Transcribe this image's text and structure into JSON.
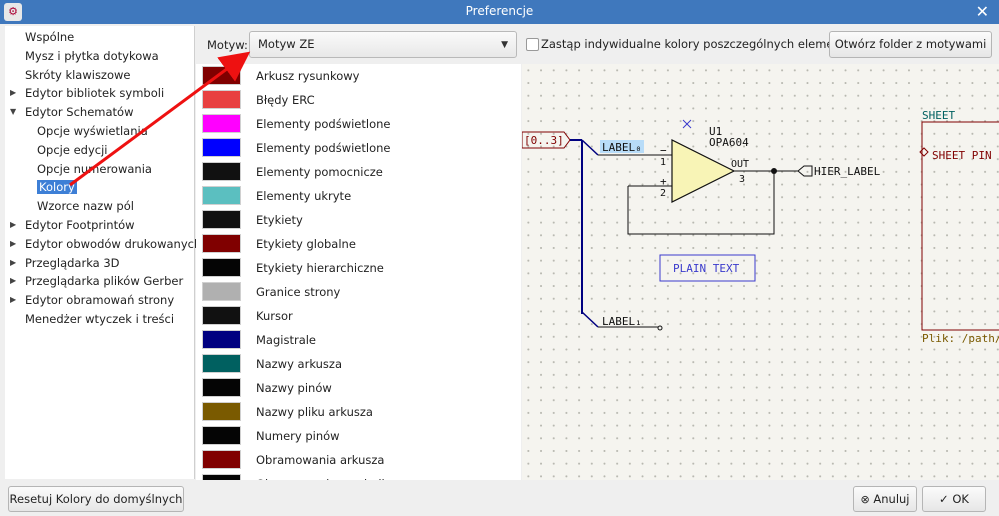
{
  "window": {
    "title": "Preferencje",
    "close_glyph": "✕",
    "app_icon": "kicad-icon"
  },
  "tree": [
    {
      "label": "Wspólne",
      "expandable": false
    },
    {
      "label": "Mysz i płytka dotykowa",
      "expandable": false
    },
    {
      "label": "Skróty klawiszowe",
      "expandable": false
    },
    {
      "label": "Edytor bibliotek symboli",
      "expandable": true,
      "expanded": false
    },
    {
      "label": "Edytor Schematów",
      "expandable": true,
      "expanded": true
    },
    {
      "label": "Opcje wyświetlania",
      "child": true
    },
    {
      "label": "Opcje edycji",
      "child": true
    },
    {
      "label": "Opcje numerowania",
      "child": true
    },
    {
      "label": "Kolory",
      "child": true,
      "selected": true
    },
    {
      "label": "Wzorce nazw pól",
      "child": true
    },
    {
      "label": "Edytor Footprintów",
      "expandable": true,
      "expanded": false
    },
    {
      "label": "Edytor obwodów drukowanych",
      "expandable": true,
      "expanded": false
    },
    {
      "label": "Przeglądarka 3D",
      "expandable": true,
      "expanded": false
    },
    {
      "label": "Przeglądarka plików Gerber",
      "expandable": true,
      "expanded": false
    },
    {
      "label": "Edytor obramowań strony",
      "expandable": true,
      "expanded": false
    },
    {
      "label": "Menedżer wtyczek i treści",
      "expandable": false
    }
  ],
  "theme": {
    "label": "Motyw:",
    "selected": "Motyw ZE",
    "override_label": "Zastąp indywidualne kolory poszczególnych elementów",
    "override_checked": false,
    "open_folder_label": "Otwórz folder z motywami"
  },
  "colors": [
    {
      "name": "Arkusz rysunkowy",
      "color": "#800000"
    },
    {
      "name": "Błędy ERC",
      "color": "#e84040"
    },
    {
      "name": "Elementy podświetlone",
      "color": "#ff00ff"
    },
    {
      "name": "Elementy podświetlone",
      "color": "#0000ff"
    },
    {
      "name": "Elementy pomocnicze",
      "color": "#111111"
    },
    {
      "name": "Elementy ukryte",
      "color": "#5bbfc0"
    },
    {
      "name": "Etykiety",
      "color": "#111111"
    },
    {
      "name": "Etykiety globalne",
      "color": "#800000"
    },
    {
      "name": "Etykiety hierarchiczne",
      "color": "#050505"
    },
    {
      "name": "Granice strony",
      "color": "#b0b0b0"
    },
    {
      "name": "Kursor",
      "color": "#111111"
    },
    {
      "name": "Magistrale",
      "color": "#000080"
    },
    {
      "name": "Nazwy arkusza",
      "color": "#006060"
    },
    {
      "name": "Nazwy pinów",
      "color": "#050505"
    },
    {
      "name": "Nazwy pliku arkusza",
      "color": "#7a5a00"
    },
    {
      "name": "Numery pinów",
      "color": "#050505"
    },
    {
      "name": "Obramowania arkusza",
      "color": "#800000"
    },
    {
      "name": "Obramowania symboli",
      "color": "#050505"
    }
  ],
  "preview": {
    "bus_label": "[0..3]",
    "label0": "LABEL₀",
    "label1": "LABEL₁",
    "ref": "U1",
    "value": "OPA604",
    "pin_minus": "−",
    "pin_plus": "+",
    "pin1": "1",
    "pin2": "2",
    "pin3": "3",
    "out": "OUT",
    "hier_label": "HIER_LABEL",
    "plain_text": "PLAIN TEXT",
    "sheet": "SHEET",
    "sheet_pin": "SHEET PIN",
    "sheet_file": "Plik: /path/"
  },
  "buttons": {
    "reset": "Resetuj Kolory do domyślnych",
    "cancel": "Anuluj",
    "ok": "OK"
  }
}
